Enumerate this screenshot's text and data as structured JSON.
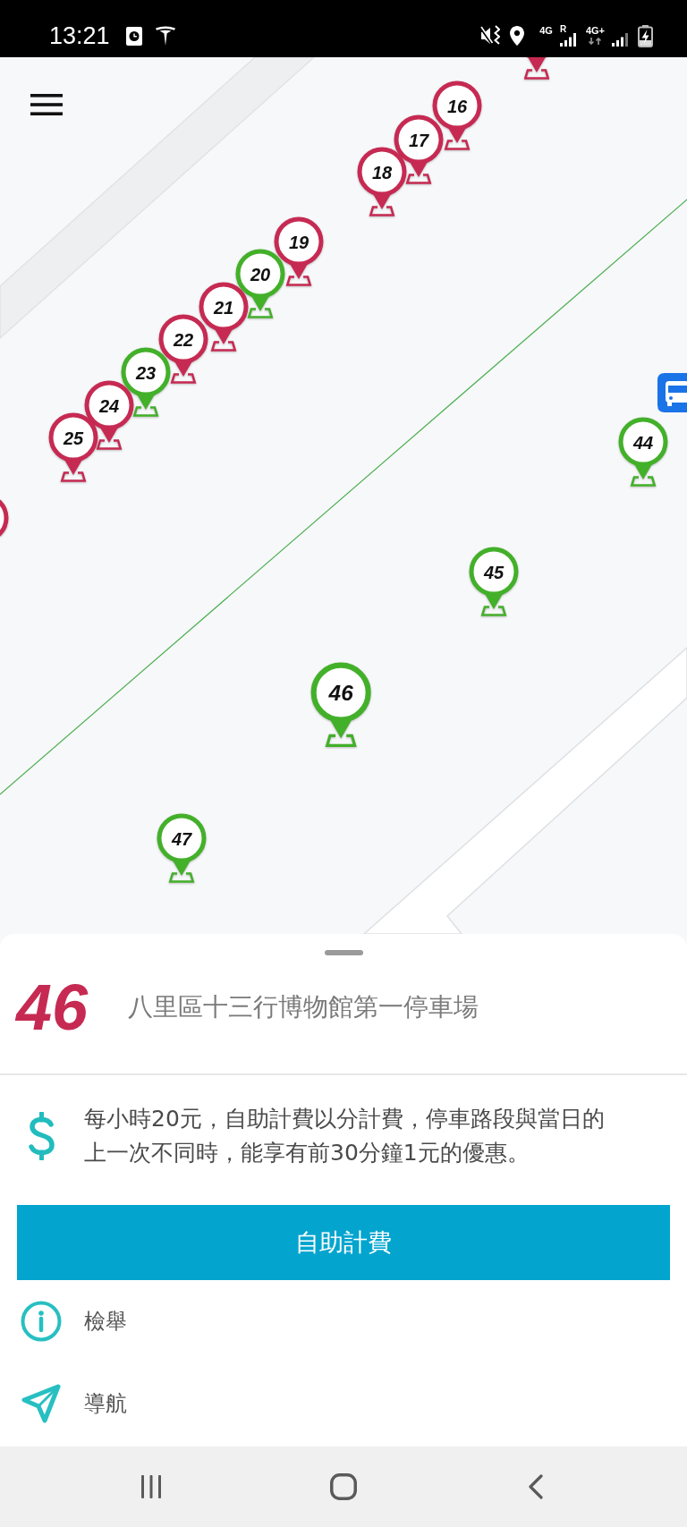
{
  "status_bar": {
    "time": "13:21",
    "sims": [
      {
        "network": "4G",
        "roaming": "R",
        "data_active": false
      },
      {
        "network": "4G+",
        "data_active": true
      }
    ]
  },
  "map": {
    "pins": [
      {
        "color": "#c62a52",
        "selected": false
      },
      {
        "number": "16",
        "color": "#c62a52",
        "selected": false
      },
      {
        "number": "17",
        "color": "#c62a52",
        "selected": false
      },
      {
        "number": "18",
        "color": "#c62a52",
        "selected": false
      },
      {
        "number": "19",
        "color": "#c62a52",
        "selected": false
      },
      {
        "number": "20",
        "color": "#43b02a",
        "selected": false
      },
      {
        "number": "21",
        "color": "#c62a52",
        "selected": false
      },
      {
        "number": "22",
        "color": "#c62a52",
        "selected": false
      },
      {
        "number": "23",
        "color": "#43b02a",
        "selected": false
      },
      {
        "number": "24",
        "color": "#c62a52",
        "selected": false
      },
      {
        "number": "25",
        "color": "#c62a52",
        "selected": false
      },
      {
        "number": "44",
        "color": "#43b02a",
        "selected": false
      },
      {
        "color": "#c62a52",
        "selected": false
      },
      {
        "number": "45",
        "color": "#43b02a",
        "selected": false
      },
      {
        "number": "46",
        "color": "#43b02a",
        "selected": true
      },
      {
        "number": "47",
        "color": "#43b02a",
        "selected": false
      }
    ]
  },
  "sheet": {
    "number": "46",
    "name": "八里區十三行博物館第一停車場",
    "fee": "每小時20元，自助計費以分計費，停車路段與當日的上一次不同時，能享有前30分鐘1元的優惠。",
    "pay_button": "自助計費",
    "actions": [
      {
        "kind": "report",
        "label": "檢舉"
      },
      {
        "kind": "navigate",
        "label": "導航"
      }
    ]
  }
}
